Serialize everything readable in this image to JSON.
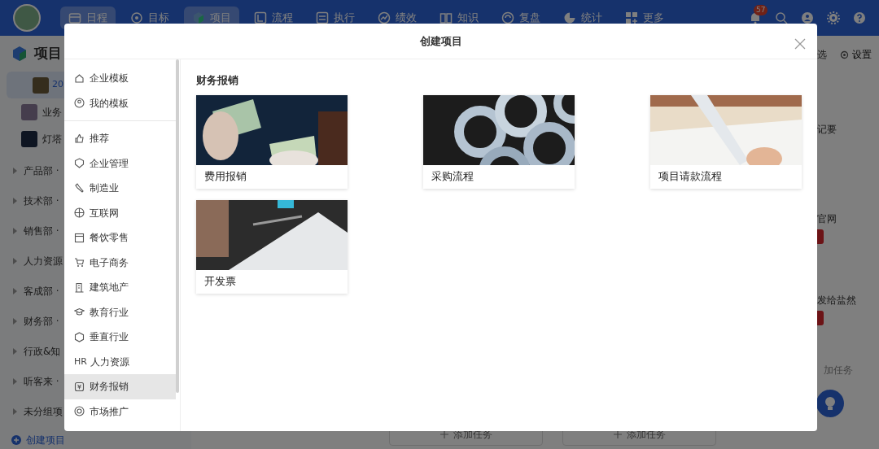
{
  "nav": {
    "tabs": [
      {
        "label": "日程",
        "selected": true
      },
      {
        "label": "目标",
        "selected": false
      },
      {
        "label": "项目",
        "selected": true
      },
      {
        "label": "流程",
        "selected": false
      },
      {
        "label": "执行",
        "selected": false
      },
      {
        "label": "绩效",
        "selected": false
      },
      {
        "label": "知识",
        "selected": false
      },
      {
        "label": "复盘",
        "selected": false
      },
      {
        "label": "统计",
        "selected": false
      },
      {
        "label": "更多",
        "selected": false
      }
    ],
    "notification_badge": "57"
  },
  "sidebar": {
    "title": "项目",
    "projects": [
      {
        "label": "20",
        "selected": true
      },
      {
        "label": "业务",
        "selected": false
      },
      {
        "label": "灯塔",
        "selected": false
      }
    ],
    "groups": [
      "产品部 ·",
      "技术部 ·",
      "销售部 ·",
      "人力资源",
      "客成部 ·",
      "财务部 ·",
      "行政&知",
      "听客来 ·",
      "未分组项"
    ],
    "create_button": "创建项目"
  },
  "right_panel": {
    "filter": "选",
    "settings": "设置",
    "tasks": [
      {
        "label": "记要",
        "tag": false
      },
      {
        "label": "官网",
        "tag": true
      },
      {
        "label": "发给盐然",
        "tag": true
      }
    ],
    "add_task": "加任务"
  },
  "board": {
    "add_task_buttons": [
      "添加任务",
      "添加任务"
    ]
  },
  "modal": {
    "title": "创建项目",
    "menu_sections": [
      [
        {
          "label": "企业模板",
          "selected": false
        },
        {
          "label": "我的模板",
          "selected": false
        }
      ],
      [
        {
          "label": "推荐",
          "selected": false
        },
        {
          "label": "企业管理",
          "selected": false
        },
        {
          "label": "制造业",
          "selected": false
        },
        {
          "label": "互联网",
          "selected": false
        },
        {
          "label": "餐饮零售",
          "selected": false
        },
        {
          "label": "电子商务",
          "selected": false
        },
        {
          "label": "建筑地产",
          "selected": false
        },
        {
          "label": "教育行业",
          "selected": false
        },
        {
          "label": "垂直行业",
          "selected": false
        },
        {
          "label": "人力资源",
          "selected": false,
          "icon_text": "HR"
        },
        {
          "label": "财务报销",
          "selected": true
        },
        {
          "label": "市场推广",
          "selected": false
        }
      ]
    ],
    "section_title": "财务报销",
    "templates": [
      {
        "label": "费用报销"
      },
      {
        "label": "采购流程"
      },
      {
        "label": "项目请款流程"
      },
      {
        "label": "开发票"
      }
    ]
  }
}
